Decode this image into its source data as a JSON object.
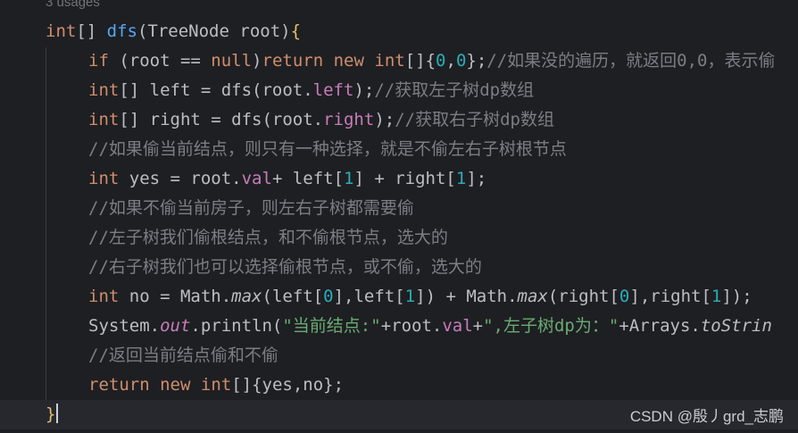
{
  "editor": {
    "usages": "3 usages",
    "lines": [
      [
        {
          "t": "int",
          "c": "kw"
        },
        {
          "t": "[] "
        },
        {
          "t": "dfs",
          "c": "fn"
        },
        {
          "t": "(TreeNode root)"
        },
        {
          "t": "{",
          "c": "brace"
        }
      ],
      [
        {
          "t": "if",
          "c": "kw"
        },
        {
          "t": " (root == "
        },
        {
          "t": "null",
          "c": "kw"
        },
        {
          "t": ")"
        },
        {
          "t": "return",
          "c": "kw"
        },
        {
          "t": " "
        },
        {
          "t": "new",
          "c": "kw"
        },
        {
          "t": " "
        },
        {
          "t": "int",
          "c": "kw"
        },
        {
          "t": "[]{"
        },
        {
          "t": "0",
          "c": "num"
        },
        {
          "t": ","
        },
        {
          "t": "0",
          "c": "num"
        },
        {
          "t": "};"
        },
        {
          "t": "//如果没的遍历，就返回0,0，表示偷",
          "c": "cmt"
        }
      ],
      [
        {
          "t": "int",
          "c": "kw"
        },
        {
          "t": "[] left = dfs(root."
        },
        {
          "t": "left",
          "c": "fld"
        },
        {
          "t": ");"
        },
        {
          "t": "//获取左子树dp数组",
          "c": "cmt"
        }
      ],
      [
        {
          "t": "int",
          "c": "kw"
        },
        {
          "t": "[] right = dfs(root."
        },
        {
          "t": "right",
          "c": "fld"
        },
        {
          "t": ");"
        },
        {
          "t": "//获取右子树dp数组",
          "c": "cmt"
        }
      ],
      [
        {
          "t": "//如果偷当前结点，则只有一种选择，就是不偷左右子树根节点",
          "c": "cmt"
        }
      ],
      [
        {
          "t": "int",
          "c": "kw"
        },
        {
          "t": " yes = root."
        },
        {
          "t": "val",
          "c": "fld"
        },
        {
          "t": "+ left["
        },
        {
          "t": "1",
          "c": "num"
        },
        {
          "t": "] + right["
        },
        {
          "t": "1",
          "c": "num"
        },
        {
          "t": "];"
        }
      ],
      [
        {
          "t": "//如果不偷当前房子，则左右子树都需要偷",
          "c": "cmt"
        }
      ],
      [
        {
          "t": "//左子树我们偷根结点，和不偷根节点，选大的",
          "c": "cmt"
        }
      ],
      [
        {
          "t": "//右子树我们也可以选择偷根节点，或不偷，选大的",
          "c": "cmt"
        }
      ],
      [
        {
          "t": "int",
          "c": "kw"
        },
        {
          "t": " no = Math."
        },
        {
          "t": "max",
          "c": "it"
        },
        {
          "t": "(left["
        },
        {
          "t": "0",
          "c": "num"
        },
        {
          "t": "],left["
        },
        {
          "t": "1",
          "c": "num"
        },
        {
          "t": "]) + Math."
        },
        {
          "t": "max",
          "c": "it"
        },
        {
          "t": "(right["
        },
        {
          "t": "0",
          "c": "num"
        },
        {
          "t": "],right["
        },
        {
          "t": "1",
          "c": "num"
        },
        {
          "t": "]);"
        }
      ],
      [
        {
          "t": "System."
        },
        {
          "t": "out",
          "c": "fld it"
        },
        {
          "t": ".println("
        },
        {
          "t": "\"当前结点:\"",
          "c": "str"
        },
        {
          "t": "+root."
        },
        {
          "t": "val",
          "c": "fld"
        },
        {
          "t": "+"
        },
        {
          "t": "\",左子树dp为：\"",
          "c": "str"
        },
        {
          "t": "+Arrays."
        },
        {
          "t": "toStrin",
          "c": "it"
        }
      ],
      [
        {
          "t": "//返回当前结点偷和不偷",
          "c": "cmt"
        }
      ],
      [
        {
          "t": "return",
          "c": "kw"
        },
        {
          "t": " "
        },
        {
          "t": "new",
          "c": "kw"
        },
        {
          "t": " "
        },
        {
          "t": "int",
          "c": "kw"
        },
        {
          "t": "[]{yes,no};"
        }
      ],
      [
        {
          "t": "}",
          "c": "brace"
        }
      ]
    ]
  },
  "watermark": "CSDN @殷丿grd_志鹏"
}
